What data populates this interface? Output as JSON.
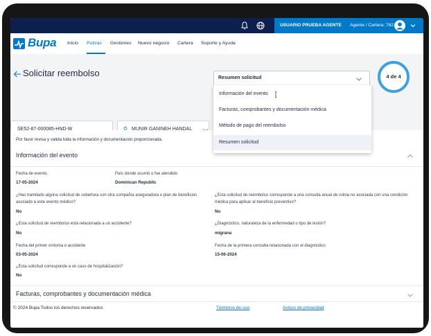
{
  "topbar": {
    "user_name": "USUARIO PRUEBA AGENTE",
    "user_role": "Agente / Cartera: 762",
    "icons": [
      "bell-icon",
      "globe-icon",
      "user-avatar-icon",
      "chevron-down-icon"
    ]
  },
  "nav": {
    "logo": "Bupa",
    "items": [
      "Inicio",
      "Polizas",
      "Gestiones",
      "Nuevo negocio",
      "Cartera",
      "Soporte y Ayuda"
    ],
    "active": "Polizas"
  },
  "header": {
    "title": "Solicitar reembolso",
    "section_select_value": "Resumen solicitud",
    "step_indicator": "4 de 4",
    "policy_number": "SE52-87-000085-HND-W",
    "insured_name": "MUNIR GANINEH HANDAL"
  },
  "dropdown": {
    "options": [
      "Información del evento",
      "Facturas, comprobantes y documentación médica",
      "Método de pago del reembolso",
      "Resumen solicitud"
    ],
    "selected": "Resumen solicitud"
  },
  "content": {
    "intro": "Por favor revisa y valida toda la información y documentación proporcionada.",
    "section_event": "Información del evento",
    "fields": {
      "fecha_evento_label": "Fecha de evento",
      "fecha_evento_value": "17-05-2024",
      "pais_label": "País donde ocurrió o fue atendido",
      "pais_value": "Dominican Republic",
      "tramite_label": "¿Has tramitado alguna solicitud de cobertura con otra compañía aseguradora o plan de beneficios asociado a este evento médico?",
      "tramite_value": "No",
      "anual_label": "¿Esta solicitud de reembolso corresponde a una consulta anual de rutina no asociada con una condición médica para aplicar al beneficio preventivo?",
      "anual_value": "No",
      "accidente_label": "¿Esta solicitud de reembolso está relacionada a un accidente?",
      "accidente_value": "No",
      "diagnostico_label": "¿Diagnóstico, naturaleza de la enfermedad o tipo de lesión?",
      "diagnostico_value": "migrana",
      "sintoma_label": "Fecha del primer síntoma o accidente",
      "sintoma_value": "03-05-2024",
      "consulta_label": "Fecha de la primera consulta relacionada con el diagnóstico",
      "consulta_value": "15-06-2024",
      "hosp_label": "¿Esta solicitud corresponde a un caso de hospitalización?",
      "hosp_value": "No"
    },
    "section_docs": "Facturas, comprobantes y documentación médica"
  },
  "footer": {
    "copyright": "© 2024 Bupa Todos los derechos reservados",
    "terms": "Términos de uso",
    "privacy": "Avisos de privacidad"
  },
  "colors": {
    "brand_blue": "#0079c8",
    "topbar_navy": "#0d1f4f",
    "step_ring": "#3fa0e0"
  }
}
